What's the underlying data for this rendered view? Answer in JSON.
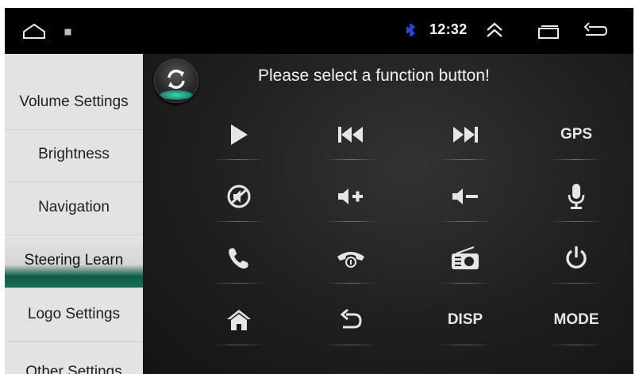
{
  "status_bar": {
    "time": "12:32"
  },
  "sidebar": {
    "items": [
      {
        "label": "Volume Settings",
        "active": false
      },
      {
        "label": "Brightness",
        "active": false
      },
      {
        "label": "Navigation",
        "active": false
      },
      {
        "label": "Steering Learn",
        "active": true
      },
      {
        "label": "Logo Settings",
        "active": false
      },
      {
        "label": "Other Settings",
        "active": false
      }
    ]
  },
  "main": {
    "prompt": "Please select a function button!",
    "buttons": {
      "play": {
        "icon": "play-icon"
      },
      "prev": {
        "icon": "previous-track-icon"
      },
      "next": {
        "icon": "next-track-icon"
      },
      "gps": {
        "label": "GPS"
      },
      "mute": {
        "icon": "mute-icon"
      },
      "vol_up": {
        "icon": "volume-up-icon"
      },
      "vol_down": {
        "icon": "volume-down-icon"
      },
      "mic": {
        "icon": "microphone-icon"
      },
      "call": {
        "icon": "phone-answer-icon"
      },
      "hangup": {
        "icon": "phone-hangup-icon"
      },
      "radio": {
        "icon": "radio-icon"
      },
      "power": {
        "icon": "power-icon"
      },
      "home": {
        "icon": "home-icon"
      },
      "back": {
        "icon": "return-icon"
      },
      "disp": {
        "label": "DISP"
      },
      "mode": {
        "label": "MODE"
      }
    }
  },
  "colors": {
    "accent": "#1a8f72",
    "sidebar_bg": "#e3e3e3",
    "main_bg": "#1f1f1f"
  }
}
